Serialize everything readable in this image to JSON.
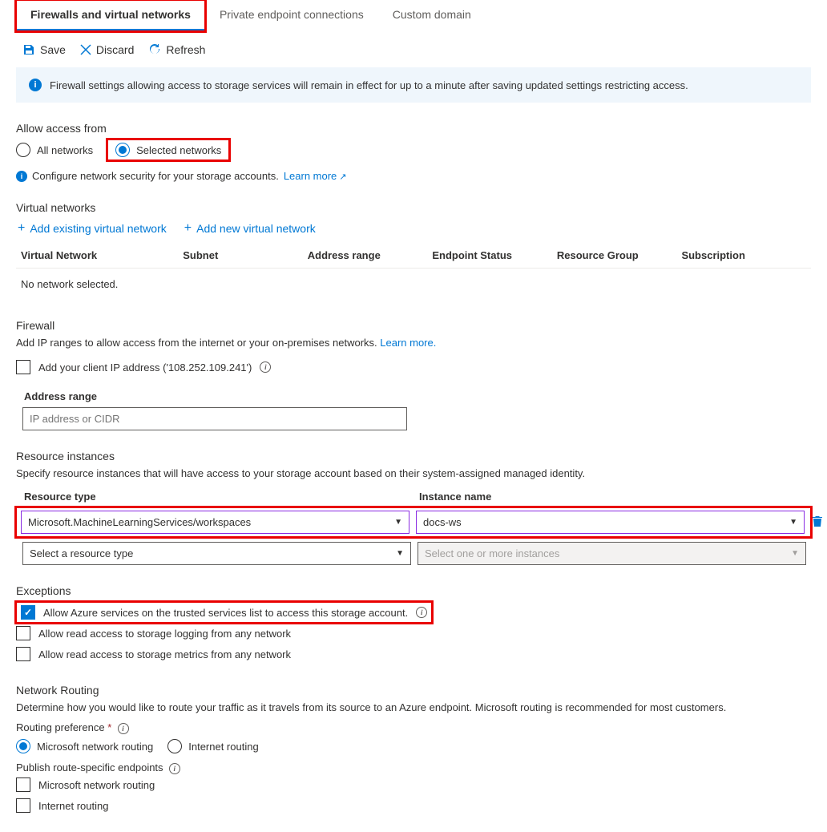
{
  "tabs": {
    "firewalls": "Firewalls and virtual networks",
    "endpoints": "Private endpoint connections",
    "custom_domain": "Custom domain"
  },
  "toolbar": {
    "save": "Save",
    "discard": "Discard",
    "refresh": "Refresh"
  },
  "banner": "Firewall settings allowing access to storage services will remain in effect for up to a minute after saving updated settings restricting access.",
  "access": {
    "title": "Allow access from",
    "all": "All networks",
    "selected": "Selected networks",
    "config_text": "Configure network security for your storage accounts.",
    "learn_more": "Learn more"
  },
  "vnet": {
    "title": "Virtual networks",
    "add_existing": "Add existing virtual network",
    "add_new": "Add new virtual network",
    "cols": {
      "network": "Virtual Network",
      "subnet": "Subnet",
      "range": "Address range",
      "endpoint": "Endpoint Status",
      "rg": "Resource Group",
      "sub": "Subscription"
    },
    "empty": "No network selected."
  },
  "firewall": {
    "title": "Firewall",
    "helper": "Add IP ranges to allow access from the internet or your on-premises networks.",
    "learn_more": "Learn more.",
    "add_client_ip": "Add your client IP address ('108.252.109.241')",
    "range_label": "Address range",
    "range_placeholder": "IP address or CIDR"
  },
  "resources": {
    "title": "Resource instances",
    "helper": "Specify resource instances that will have access to your storage account based on their system-assigned managed identity.",
    "col_type": "Resource type",
    "col_name": "Instance name",
    "row1_type": "Microsoft.MachineLearningServices/workspaces",
    "row1_name": "docs-ws",
    "row2_type": "Select a resource type",
    "row2_name": "Select one or more instances"
  },
  "exceptions": {
    "title": "Exceptions",
    "trusted": "Allow Azure services on the trusted services list to access this storage account.",
    "logging": "Allow read access to storage logging from any network",
    "metrics": "Allow read access to storage metrics from any network"
  },
  "routing": {
    "title": "Network Routing",
    "helper": "Determine how you would like to route your traffic as it travels from its source to an Azure endpoint. Microsoft routing is recommended for most customers.",
    "pref_label": "Routing preference",
    "ms": "Microsoft network routing",
    "inet": "Internet routing",
    "publish_label": "Publish route-specific endpoints",
    "pub_ms": "Microsoft network routing",
    "pub_inet": "Internet routing"
  }
}
